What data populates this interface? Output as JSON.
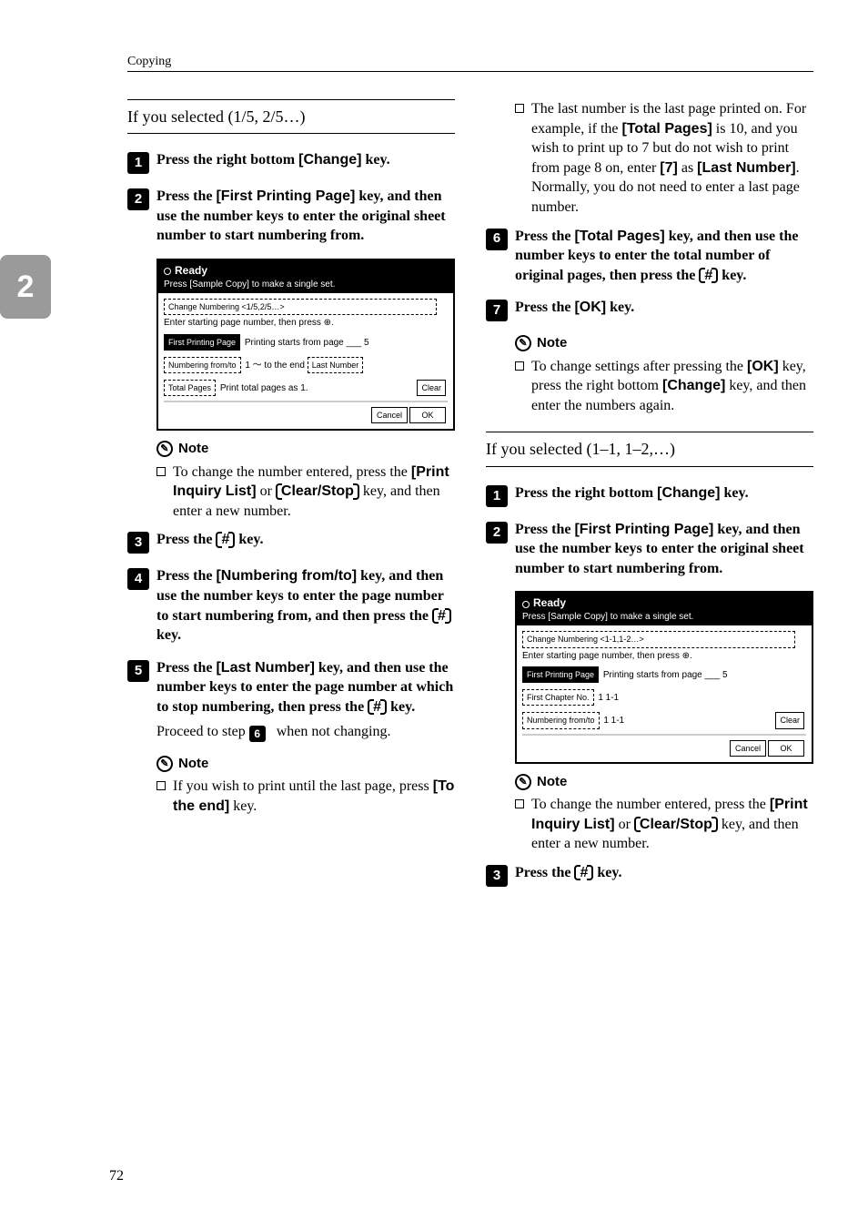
{
  "running_head": "Copying",
  "side_tab": "2",
  "page_number": "72",
  "left": {
    "subproc_title": "If you selected (1/5, 2/5…)",
    "steps": {
      "s1": {
        "num": "1",
        "pre": "Press the right bottom ",
        "ui": "[Change]",
        "post": " key."
      },
      "s2": {
        "num": "2",
        "pre": "Press the ",
        "ui": "[First Printing Page]",
        "post": " key, and then use the number keys to enter the original sheet number to start numbering from."
      },
      "s3": {
        "num": "3",
        "pre": "Press the ",
        "key": "#",
        "post": " key."
      },
      "s4": {
        "num": "4",
        "pre": "Press the ",
        "ui": "[Numbering from/to]",
        "mid": " key, and then use the number keys to enter the page number to start numbering from, and then press the ",
        "key": "#",
        "post": " key."
      },
      "s5": {
        "num": "5",
        "pre": "Press the ",
        "ui": "[Last Number]",
        "mid": " key, and then use the number keys to enter the page number at which to stop numbering, then press the ",
        "key": "#",
        "post": " key."
      },
      "s5_extra": {
        "pre": "Proceed to step ",
        "num": "6",
        "post": " when not changing."
      }
    },
    "note1_head": "Note",
    "note1_body": {
      "pre": "To change the number entered, press the ",
      "ui": "[Print Inquiry List]",
      "mid": " or ",
      "key": "Clear/Stop",
      "post": " key, and then enter a new number."
    },
    "note2_head": "Note",
    "note2_body": {
      "pre": "If you wish to print until the last page, press ",
      "ui": "[To the end]",
      "post": " key."
    },
    "screenshot": {
      "status": "Ready",
      "hint": "Press [Sample Copy] to make a single set.",
      "title": "Change Numbering   <1/5,2/5…>",
      "instruction": "Enter starting page number, then press ⊕.",
      "row1_label": "First Printing Page",
      "row1_value": "Printing starts from page ___ 5",
      "row2_label": "Numbering from/to",
      "row2_value": "1  ～ to the end",
      "row2_btn": "Last Number",
      "row3_label": "Total Pages",
      "row3_value": "Print total pages as          1.",
      "clear_btn": "Clear",
      "cancel_btn": "Cancel",
      "ok_btn": "OK"
    }
  },
  "right": {
    "top_bullet": {
      "pre": "The last number is the last page printed on. For example, if the ",
      "ui1": "[Total Pages]",
      "mid1": " is 10, and you wish to print up to 7 but do not wish to print from page 8 on, enter ",
      "ui2": "[7]",
      "mid2": " as ",
      "ui3": "[Last Number]",
      "post": ". Normally, you do not need to enter a last page number."
    },
    "s6": {
      "num": "6",
      "pre": "Press the ",
      "ui": "[Total Pages]",
      "mid": " key, and then use the number keys to enter the total number of original pages, then press the ",
      "key": "#",
      "post": " key."
    },
    "s7": {
      "num": "7",
      "pre": "Press the ",
      "ui": "[OK]",
      "post": " key."
    },
    "note1_head": "Note",
    "note1_body": {
      "pre": "To change settings after pressing the ",
      "ui1": "[OK]",
      "mid": " key, press the right bottom ",
      "ui2": "[Change]",
      "post": " key, and then enter the numbers again."
    },
    "subproc_title": "If you selected (1–1, 1–2,…)",
    "steps": {
      "s1": {
        "num": "1",
        "pre": "Press the right bottom ",
        "ui": "[Change]",
        "post": " key."
      },
      "s2": {
        "num": "2",
        "pre": "Press the ",
        "ui": "[First Printing Page]",
        "post": " key, and then use the number keys to enter the original sheet number to start numbering from."
      },
      "s3": {
        "num": "3",
        "pre": "Press the ",
        "key": "#",
        "post": " key."
      }
    },
    "note2_head": "Note",
    "note2_body": {
      "pre": "To change the number entered, press the ",
      "ui": "[Print Inquiry List]",
      "mid": " or ",
      "key": "Clear/Stop",
      "post": " key, and then enter a new number."
    },
    "screenshot": {
      "status": "Ready",
      "hint": "Press [Sample Copy] to make a single set.",
      "title": "Change Numbering   <1-1,1-2…>",
      "instruction": "Enter starting page number, then press ⊕.",
      "row1_label": "First Printing Page",
      "row1_value": "Printing starts from page ___ 5",
      "row2_label": "First Chapter No.",
      "row2_value": "1   1-1",
      "row3_label": "Numbering from/to",
      "row3_value": "1   1-1",
      "clear_btn": "Clear",
      "cancel_btn": "Cancel",
      "ok_btn": "OK"
    }
  }
}
